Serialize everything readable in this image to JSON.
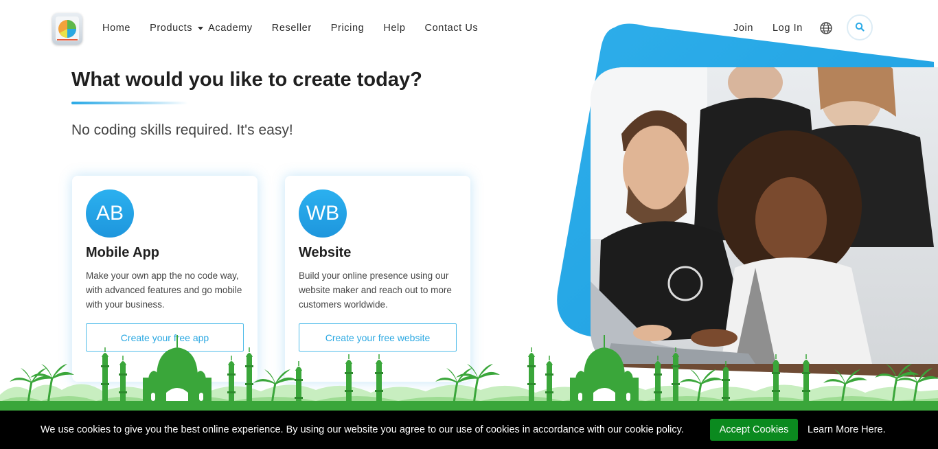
{
  "header": {
    "logo_icon": "pie-chart-logo-icon",
    "nav": [
      {
        "label": "Home"
      },
      {
        "label": "Products",
        "has_dropdown": true
      },
      {
        "label": "Academy"
      },
      {
        "label": "Reseller"
      },
      {
        "label": "Pricing"
      },
      {
        "label": "Help"
      },
      {
        "label": "Contact Us"
      }
    ],
    "join_label": "Join",
    "login_label": "Log In",
    "globe_icon": "globe-icon",
    "search_icon": "search-icon"
  },
  "hero": {
    "title": "What would you like to create today?",
    "subtitle": "No coding skills required. It's easy!"
  },
  "cards": [
    {
      "badge": "AB",
      "title": "Mobile App",
      "description": "Make your own app the no code way, with advanced features and go mobile with your business.",
      "button": "Create your free app"
    },
    {
      "badge": "WB",
      "title": "Website",
      "description": "Build your online presence using our website maker and reach out to more customers worldwide.",
      "button": "Create your free website"
    }
  ],
  "colors": {
    "accent": "#29a9e6",
    "accept_green": "#0b8a1f",
    "skyline_green": "#3aa63a",
    "cookie_bg": "#000000"
  },
  "cookie": {
    "text": "We use cookies to give you the best online experience. By using our website you agree to our use of cookies in accordance with our cookie policy.",
    "accept": "Accept Cookies",
    "learn_more": "Learn More Here."
  }
}
